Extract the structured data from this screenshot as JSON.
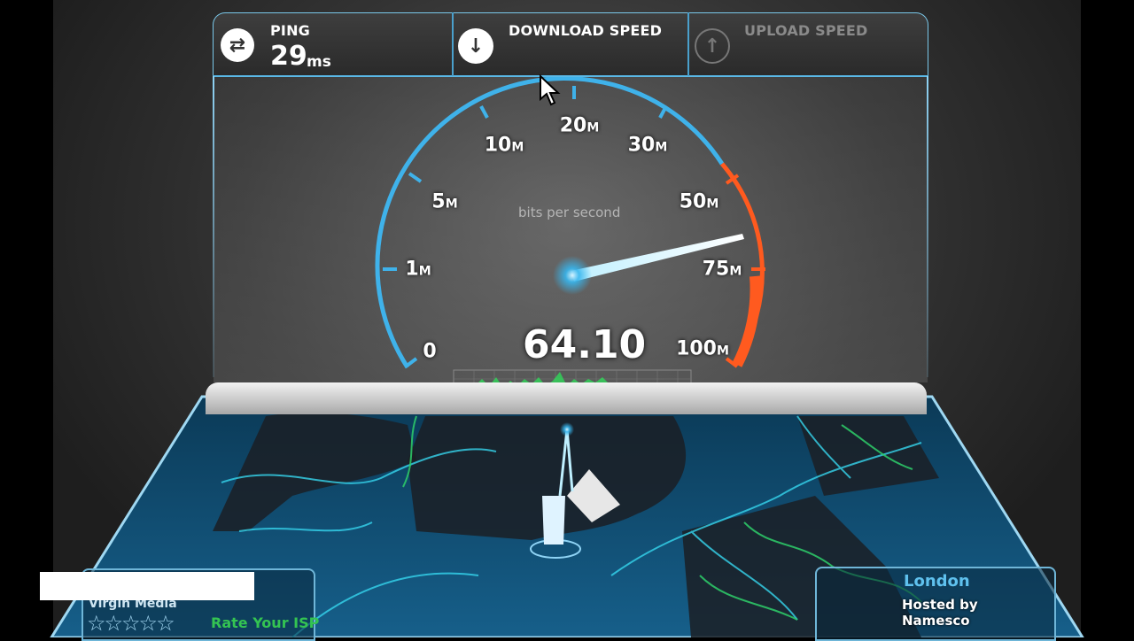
{
  "header": {
    "ping_label": "PING",
    "ping_value": "29",
    "ping_unit": "ms",
    "download_label": "DOWNLOAD SPEED",
    "upload_label": "UPLOAD SPEED"
  },
  "gauge": {
    "unit_label": "bits per second",
    "current_speed": "64.10",
    "ticks": [
      {
        "value": "0",
        "suffix": ""
      },
      {
        "value": "1",
        "suffix": "M"
      },
      {
        "value": "5",
        "suffix": "M"
      },
      {
        "value": "10",
        "suffix": "M"
      },
      {
        "value": "20",
        "suffix": "M"
      },
      {
        "value": "30",
        "suffix": "M"
      },
      {
        "value": "50",
        "suffix": "M"
      },
      {
        "value": "75",
        "suffix": "M"
      },
      {
        "value": "100",
        "suffix": "M"
      }
    ]
  },
  "isp": {
    "name": "Virgin Media",
    "rating_stars": 0,
    "rate_label": "Rate Your ISP"
  },
  "server": {
    "city": "London",
    "hosted_label": "Hosted by",
    "host": "Namesco"
  },
  "colors": {
    "accent_blue": "#3fb2ea",
    "accent_orange": "#ff5a1f",
    "graph_green": "#2ee05a"
  },
  "icons": {
    "ping": "swap-arrows-icon",
    "download": "arrow-down-circle-icon",
    "upload": "arrow-up-circle-icon",
    "cursor": "mouse-pointer-icon"
  }
}
